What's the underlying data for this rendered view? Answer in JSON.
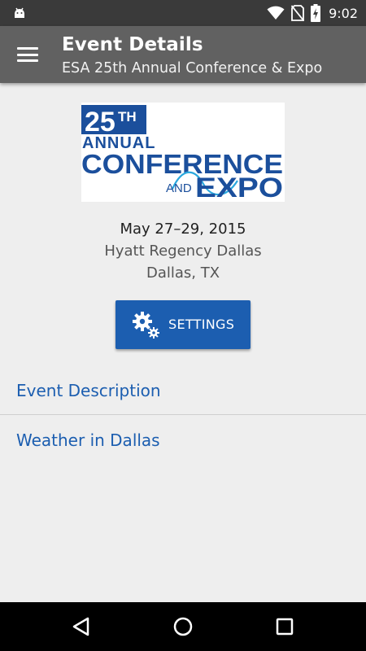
{
  "status_bar": {
    "time": "9:02",
    "icons": [
      "android-debug-icon",
      "wifi-icon",
      "no-sim-icon",
      "battery-charging-icon"
    ]
  },
  "app_bar": {
    "title": "Event Details",
    "subtitle": "ESA 25th Annual Conference & Expo",
    "menu_icon": "hamburger-menu-icon"
  },
  "logo": {
    "number": "25",
    "suffix": "TH",
    "line1": "ANNUAL",
    "line2": "CONFERENCE",
    "and": "AND",
    "expo": "EXPO",
    "colors": {
      "navy": "#1b4f9c",
      "light_blue": "#2aa8de"
    }
  },
  "event": {
    "date": "May 27–29, 2015",
    "venue": "Hyatt Regency Dallas",
    "city": "Dallas, TX"
  },
  "settings_button": {
    "label": "SETTINGS",
    "icon": "gears-icon",
    "color": "#1c5eb0"
  },
  "links": {
    "event_description": "Event Description",
    "weather": "Weather in Dallas",
    "color": "#1c5eb0"
  },
  "nav_bar": {
    "back_icon": "back-triangle-icon",
    "home_icon": "home-circle-icon",
    "recents_icon": "recents-square-icon"
  }
}
